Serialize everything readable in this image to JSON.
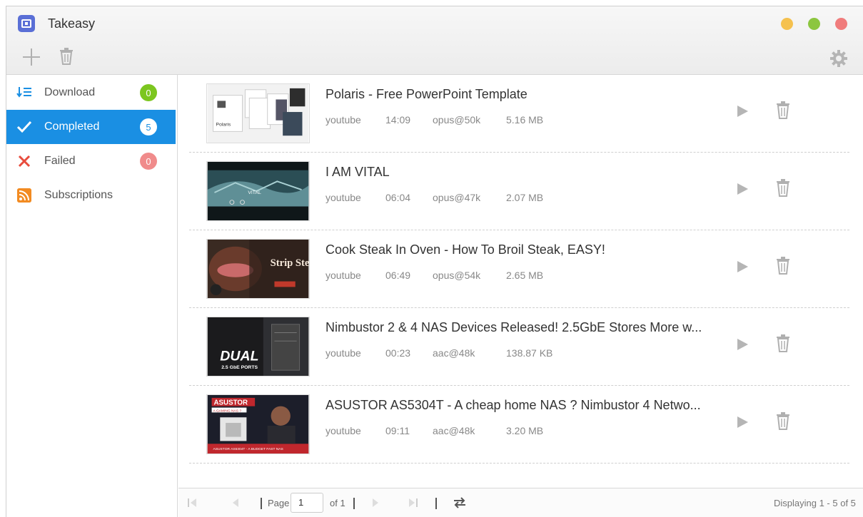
{
  "app": {
    "title": "Takeasy"
  },
  "sidebar": {
    "items": [
      {
        "label": "Download",
        "count": "0"
      },
      {
        "label": "Completed",
        "count": "5"
      },
      {
        "label": "Failed",
        "count": "0"
      },
      {
        "label": "Subscriptions"
      }
    ]
  },
  "downloads": [
    {
      "title": "Polaris - Free PowerPoint Template",
      "source": "youtube",
      "duration": "14:09",
      "format": "opus@50k",
      "size": "5.16 MB"
    },
    {
      "title": "I AM VITAL",
      "source": "youtube",
      "duration": "06:04",
      "format": "opus@47k",
      "size": "2.07 MB"
    },
    {
      "title": "Cook Steak In Oven - How To Broil Steak, EASY!",
      "source": "youtube",
      "duration": "06:49",
      "format": "opus@54k",
      "size": "2.65 MB"
    },
    {
      "title": "Nimbustor 2 & 4 NAS Devices Released! 2.5GbE Stores More w...",
      "source": "youtube",
      "duration": "00:23",
      "format": "aac@48k",
      "size": "138.87 KB"
    },
    {
      "title": "ASUSTOR AS5304T - A cheap home NAS ? Nimbustor 4 Netwo...",
      "source": "youtube",
      "duration": "09:11",
      "format": "aac@48k",
      "size": "3.20 MB"
    }
  ],
  "thumbnails": [
    {
      "caption": "Polaris"
    },
    {
      "caption": "VITAL"
    },
    {
      "caption": "Strip Steak"
    },
    {
      "caption": "DUAL",
      "subcaption": "2.5 GbE PORTS"
    },
    {
      "caption": "ASUSTOR",
      "subcaption": "A GAMING NAS ?",
      "footer": "ASUSTOR AS5304T - A BUDGET FAST NAS"
    }
  ],
  "pager": {
    "page_label": "Page",
    "page_value": "1",
    "of_label": "of 1",
    "display_text": "Displaying 1 - 5 of 5"
  },
  "colors": {
    "accent": "#1a8fe3",
    "badge_green": "#7cc61f",
    "badge_red": "#f08b8b",
    "rss_orange": "#f28b22"
  }
}
